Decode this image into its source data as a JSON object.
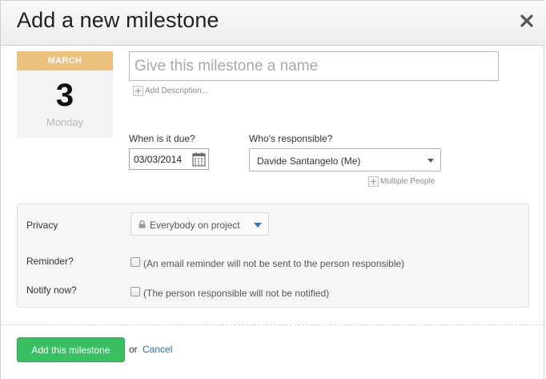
{
  "dialog": {
    "title": "Add a new milestone",
    "close_icon": "close-icon"
  },
  "calendar": {
    "month": "MARCH",
    "day": "3",
    "weekday": "Monday"
  },
  "name_field": {
    "value": "",
    "placeholder": "Give this milestone a name"
  },
  "add_description": {
    "icon": "plus-icon",
    "label": "Add Description..."
  },
  "due": {
    "label": "When is it due?",
    "value": "03/03/2014",
    "icon": "calendar-icon"
  },
  "responsible": {
    "label": "Who's responsible?",
    "value": "Davide Santangelo (Me)",
    "icon": "dropdown-arrow-icon"
  },
  "multiple_people": {
    "icon": "plus-icon",
    "label": "Multiple People"
  },
  "options": {
    "privacy": {
      "label": "Privacy",
      "value": "Everybody on project",
      "icon": "lock-icon",
      "arrow_color": "#3a6fb0"
    },
    "reminder": {
      "label": "Reminder?",
      "checked": false,
      "text": "(An email reminder will not be sent to the person responsible)"
    },
    "notify": {
      "label": "Notify now?",
      "checked": false,
      "text": "(The person responsible will not be notified)"
    }
  },
  "footer": {
    "submit_label": "Add this milestone",
    "or_text": "or",
    "cancel_label": "Cancel"
  },
  "colors": {
    "month_banner": "#ecc17e",
    "submit_button": "#3bbf63",
    "cancel_link": "#2a6ab0"
  }
}
